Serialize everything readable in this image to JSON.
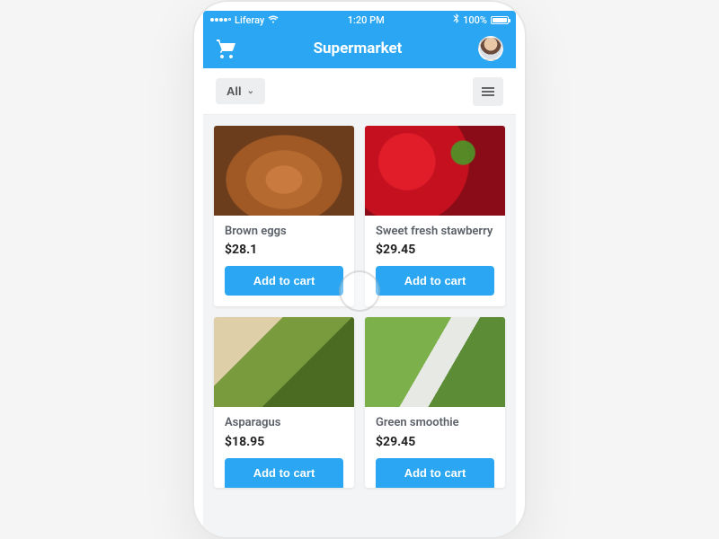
{
  "status": {
    "carrier": "Liferay",
    "time": "1:20 PM",
    "battery": "100%"
  },
  "nav": {
    "title": "Supermarket"
  },
  "filter": {
    "label": "All"
  },
  "buttons": {
    "add_to_cart": "Add to cart"
  },
  "products": [
    {
      "name": "Brown eggs",
      "price": "$28.1"
    },
    {
      "name": "Sweet fresh stawberry",
      "price": "$29.45"
    },
    {
      "name": "Asparagus",
      "price": "$18.95"
    },
    {
      "name": "Green smoothie",
      "price": "$29.45"
    }
  ],
  "colors": {
    "primary": "#2aa6f2",
    "background": "#f3f4f6"
  }
}
